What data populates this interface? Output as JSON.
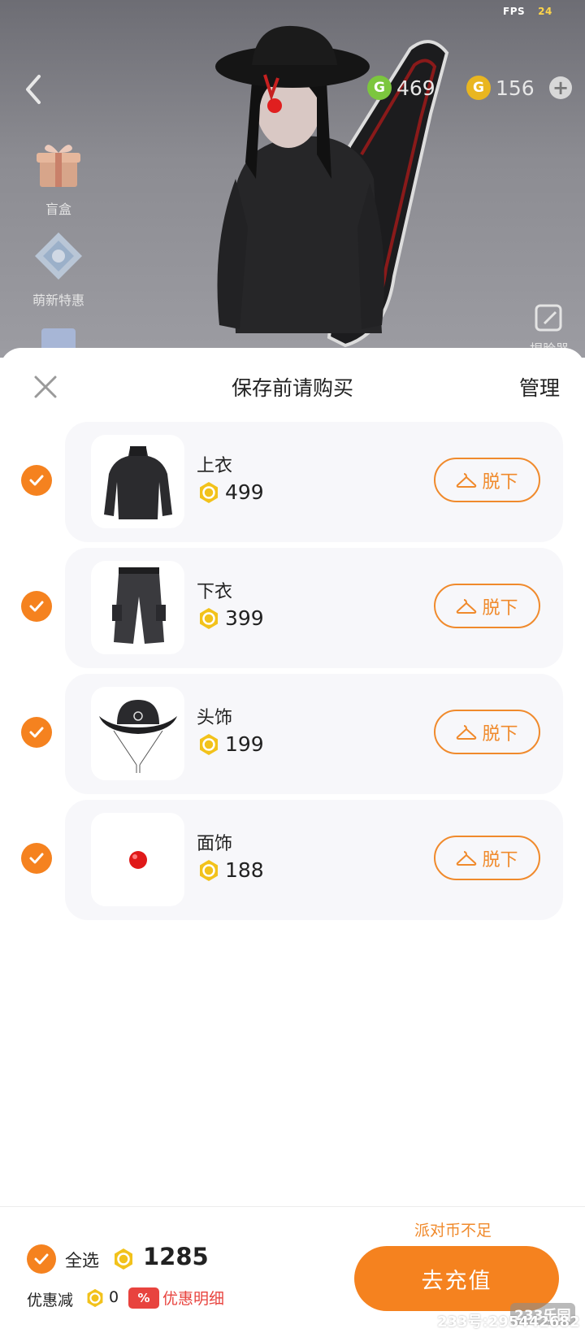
{
  "scene": {
    "fps_label": "FPS",
    "fps_value": "24",
    "currency_green": "469",
    "currency_gold": "156",
    "side_items": [
      {
        "label": "盲盒",
        "icon": "gift-box-icon"
      },
      {
        "label": "萌新特惠",
        "icon": "newbie-deal-icon"
      }
    ],
    "face_edit_label": "捏脸器"
  },
  "sheet": {
    "title": "保存前请购买",
    "manage_label": "管理",
    "items": [
      {
        "name": "上衣",
        "price": "499",
        "action": "脱下",
        "thumb": "sweater-thumbnail"
      },
      {
        "name": "下衣",
        "price": "399",
        "action": "脱下",
        "thumb": "cargo-pants-thumbnail"
      },
      {
        "name": "头饰",
        "price": "199",
        "action": "脱下",
        "thumb": "cowboy-hat-thumbnail"
      },
      {
        "name": "面饰",
        "price": "188",
        "action": "脱下",
        "thumb": "clown-nose-thumbnail"
      }
    ]
  },
  "footer": {
    "insufficient_notice": "派对币不足",
    "select_all_label": "全选",
    "total_amount": "1285",
    "discount_label": "优惠减",
    "discount_value": "0",
    "discount_badge": "%",
    "discount_detail_label": "优惠明细",
    "recharge_label": "去充值"
  },
  "watermark": {
    "logo": "233乐园",
    "id_text": "233号:295442682"
  },
  "colors": {
    "accent": "#f5821f",
    "accent_text": "#f08a2c",
    "discount_red": "#e8433e",
    "card_bg": "#f7f7fa",
    "green_coin": "#7cc63e",
    "gold_coin": "#e9b620"
  }
}
